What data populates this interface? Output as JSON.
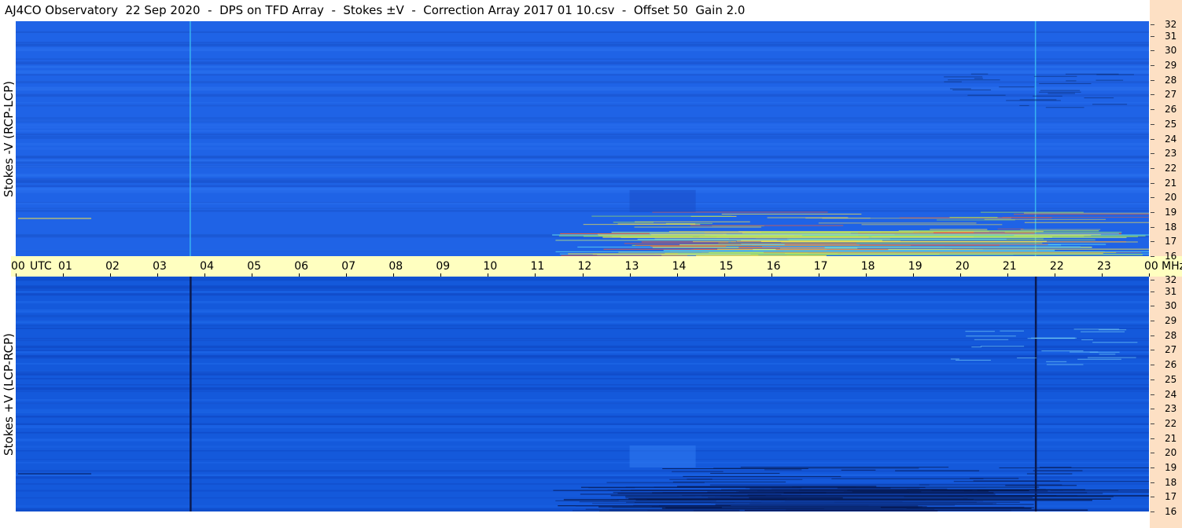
{
  "chart_data": {
    "type": "heatmap",
    "title": "AJ4CO Observatory  22 Sep 2020  -  DPS on TFD Array  -  Stokes ±V  -  Correction Array 2017 01 10.csv  -  Offset 50  Gain 2.0",
    "x_axis": {
      "unit_label": "UTC",
      "tick_labels": [
        "00",
        "01",
        "02",
        "03",
        "04",
        "05",
        "06",
        "07",
        "08",
        "09",
        "10",
        "11",
        "12",
        "13",
        "14",
        "15",
        "16",
        "17",
        "18",
        "19",
        "20",
        "21",
        "22",
        "23",
        "00"
      ],
      "range_hours": [
        0,
        24
      ]
    },
    "y_axis": {
      "unit_label": "MHz",
      "tick_labels": [
        "32",
        "31",
        "30",
        "29",
        "28",
        "27",
        "26",
        "25",
        "24",
        "23",
        "22",
        "21",
        "20",
        "19",
        "18",
        "17",
        "16"
      ],
      "range_mhz": [
        16,
        32
      ]
    },
    "panels": [
      {
        "name": "top",
        "ylabel": "Stokes -V (RCP-LCP)",
        "base_color": "#1f63e6",
        "features": [
          {
            "type": "vertical_line",
            "time_utc_h": 3.7,
            "color": "#38b4f0"
          },
          {
            "type": "vertical_line",
            "time_utc_h": 21.6,
            "color": "#38b4f0"
          },
          {
            "type": "band_emission",
            "start_utc_h": 11.3,
            "end_utc_h": 24.0,
            "freq_mhz": [
              16.0,
              17.5
            ],
            "color": "#9fe35a"
          },
          {
            "type": "dark_patch",
            "start_utc_h": 13.0,
            "end_utc_h": 14.4,
            "freq_mhz": [
              19.0,
              20.5
            ],
            "color": "#1a4fc8"
          }
        ]
      },
      {
        "name": "bottom",
        "ylabel": "Stokes +V (LCP-RCP)",
        "base_color": "#1459db",
        "features": [
          {
            "type": "vertical_line",
            "time_utc_h": 3.7,
            "color": "#0a1a50"
          },
          {
            "type": "vertical_line",
            "time_utc_h": 21.6,
            "color": "#0a1a50"
          },
          {
            "type": "band_emission",
            "start_utc_h": 11.3,
            "end_utc_h": 24.0,
            "freq_mhz": [
              16.0,
              17.5
            ],
            "color": "#0b2c80"
          },
          {
            "type": "bright_patch",
            "start_utc_h": 13.0,
            "end_utc_h": 14.4,
            "freq_mhz": [
              19.0,
              20.5
            ],
            "color": "#2f7af0"
          }
        ]
      }
    ],
    "colors": {
      "axis_band": "#ffffc0",
      "side_strip": "#fde0c4"
    }
  }
}
